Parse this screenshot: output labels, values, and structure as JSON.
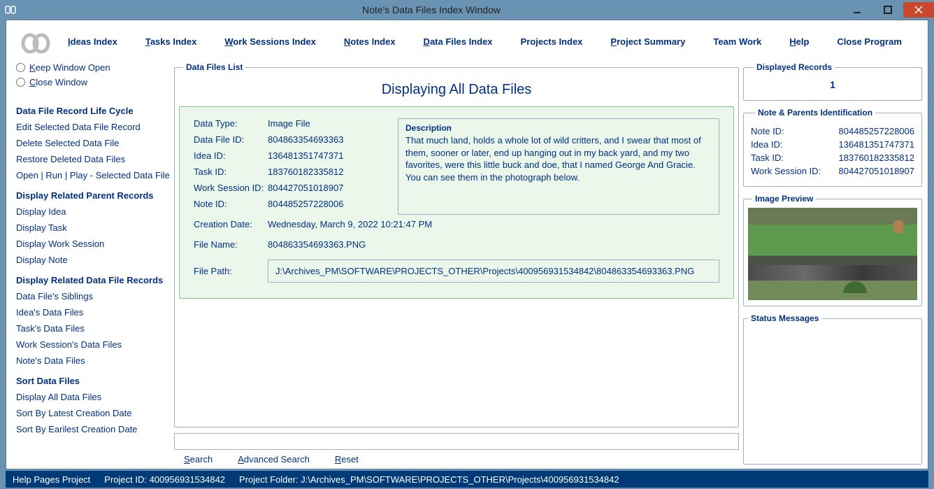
{
  "window": {
    "title": "Note's Data Files Index Window"
  },
  "menus": {
    "ideas": "Ideas Index",
    "tasks": "Tasks Index",
    "work": "Work Sessions Index",
    "notes": "Notes Index",
    "datafiles": "Data Files Index",
    "projects": "Projects Index",
    "summary": "Project Summary",
    "team": "Team Work",
    "help": "Help",
    "close": "Close Program"
  },
  "sidebar": {
    "keep_open": "Keep Window Open",
    "close_window": "Close Window",
    "lifecycle_heading": "Data File Record Life Cycle",
    "lifecycle": {
      "edit": "Edit Selected Data File Record",
      "delete": "Delete Selected Data File",
      "restore": "Restore Deleted Data Files",
      "open": "Open | Run | Play - Selected Data File"
    },
    "parents_heading": "Display Related Parent Records",
    "parents": {
      "idea": "Display Idea",
      "task": "Display Task",
      "work": "Display Work Session",
      "note": "Display Note"
    },
    "related_heading": "Display Related Data File Records",
    "related": {
      "siblings": "Data File's Siblings",
      "ideas": "Idea's Data Files",
      "tasks": "Task's Data Files",
      "work": "Work Session's Data Files",
      "notes": "Note's Data Files"
    },
    "sort_heading": "Sort Data Files",
    "sort": {
      "all": "Display All Data Files",
      "latest": "Sort By Latest Creation Date",
      "earliest": "Sort By Earilest Creation Date"
    }
  },
  "list": {
    "legend": "Data Files List",
    "heading": "Displaying All Data Files"
  },
  "record": {
    "labels": {
      "data_type": "Data Type:",
      "data_file_id": "Data File ID:",
      "idea_id": "Idea ID:",
      "task_id": "Task ID:",
      "work_id": "Work Session ID:",
      "note_id": "Note ID:",
      "creation": "Creation Date:",
      "file_name": "File Name:",
      "file_path": "File Path:",
      "desc": "Description"
    },
    "values": {
      "data_type": "Image File",
      "data_file_id": "804863354693363",
      "idea_id": "136481351747371",
      "task_id": "183760182335812",
      "work_id": "804427051018907",
      "note_id": "804485257228006",
      "creation": "Wednesday, March 9, 2022   10:21:47 PM",
      "file_name": "804863354693363.PNG",
      "file_path": "J:\\Archives_PM\\SOFTWARE\\PROJECTS_OTHER\\Projects\\400956931534842\\804863354693363.PNG",
      "description": "That much land, holds a whole lot of wild critters, and I swear that most of them, sooner or later, end up hanging out in my back yard, and my two favorites, were this little buck and doe, that I named George And Gracie. You can see them in the photograph below."
    }
  },
  "search": {
    "placeholder": "",
    "search": "Search",
    "advanced": "Advanced Search",
    "reset": "Reset"
  },
  "right": {
    "displayed_legend": "Displayed Records",
    "displayed_count": "1",
    "ids_legend": "Note & Parents Identification",
    "ids": {
      "note_lbl": "Note ID:",
      "note_val": "804485257228006",
      "idea_lbl": "Idea ID:",
      "idea_val": "136481351747371",
      "task_lbl": "Task ID:",
      "task_val": "183760182335812",
      "work_lbl": "Work Session ID:",
      "work_val": "804427051018907"
    },
    "preview_legend": "Image Preview",
    "status_legend": "Status Messages"
  },
  "statusbar": {
    "help": "Help Pages Project",
    "project_id": "Project ID:  400956931534842",
    "project_folder": "Project Folder:  J:\\Archives_PM\\SOFTWARE\\PROJECTS_OTHER\\Projects\\400956931534842"
  }
}
